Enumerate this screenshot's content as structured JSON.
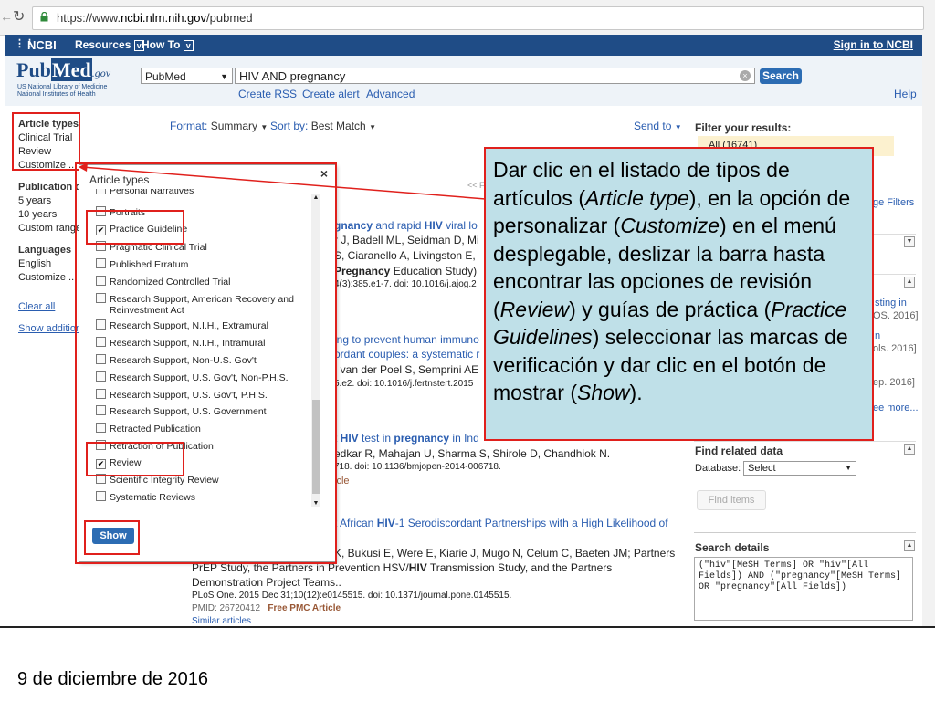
{
  "browser": {
    "url_prefix": "https://www.",
    "url_domain": "ncbi.nlm.nih.gov",
    "url_path": "/pubmed"
  },
  "ncbi_bar": {
    "logo": "NCBI",
    "resources": "Resources",
    "howto": "How To",
    "signin": "Sign in to NCBI"
  },
  "pubmed": {
    "logo_pub": "Pub",
    "logo_med": "Med",
    "logo_gov": ".gov",
    "org1": "US National Library of Medicine",
    "org2": "National Institutes of Health",
    "db_select": "PubMed",
    "query": "HIV AND pregnancy",
    "search_btn": "Search",
    "create_rss": "Create RSS",
    "create_alert": "Create alert",
    "advanced": "Advanced",
    "help": "Help"
  },
  "sidebar": {
    "article_types": "Article types",
    "clinical_trial": "Clinical Trial",
    "review": "Review",
    "customize": "Customize ...",
    "pub_dates": "Publication da",
    "five_years": "5 years",
    "ten_years": "10 years",
    "custom_range": "Custom range",
    "languages": "Languages",
    "english": "English",
    "customize2": "Customize ...",
    "clear_all": "Clear all",
    "show_additional": "Show addition"
  },
  "toolbar": {
    "format_label": "Format:",
    "format_value": "Summary",
    "sort_label": "Sort by:",
    "sort_value": "Best Match",
    "send_to": "Send to"
  },
  "popup": {
    "title": "Article types",
    "close": "×",
    "options": [
      {
        "label": "Personal Narratives",
        "checked": false
      },
      {
        "label": "Portraits",
        "checked": false
      },
      {
        "label": "Practice Guideline",
        "checked": true
      },
      {
        "label": "Pragmatic Clinical Trial",
        "checked": false
      },
      {
        "label": "Published Erratum",
        "checked": false
      },
      {
        "label": "Randomized Controlled Trial",
        "checked": false
      },
      {
        "label": "Research Support, American Recovery and",
        "label2": "Reinvestment Act",
        "checked": false
      },
      {
        "label": "Research Support, N.I.H., Extramural",
        "checked": false
      },
      {
        "label": "Research Support, N.I.H., Intramural",
        "checked": false
      },
      {
        "label": "Research Support, Non-U.S. Gov't",
        "checked": false
      },
      {
        "label": "Research Support, U.S. Gov't, Non-P.H.S.",
        "checked": false
      },
      {
        "label": "Research Support, U.S. Gov't, P.H.S.",
        "checked": false
      },
      {
        "label": "Research Support, U.S. Government",
        "checked": false
      },
      {
        "label": "Retracted Publication",
        "checked": false
      },
      {
        "label": "Retraction of Publication",
        "checked": false
      },
      {
        "label": "Review",
        "checked": true
      },
      {
        "label": "Scientific Integrity Review",
        "checked": false
      },
      {
        "label": "Systematic Reviews",
        "checked": false
      }
    ],
    "show_btn": "Show"
  },
  "results": {
    "r1_title_a": "gnancy",
    "r1_title_b": " and rapid ",
    "r1_title_c": "HIV",
    "r1_title_d": " viral lo",
    "r1_authors_a": "r J, Badell ML, Seidman D, Mi",
    "r1_authors_b": "S, Ciaranello A, Livingston E,",
    "r1_authors_c": " Pregnancy",
    "r1_authors_d": " Education Study)",
    "r1_cite": "4(3):385.e1-7. doi: 10.1016/j.ajog.2",
    "r2_title_a": "ing to prevent human immuno",
    "r2_title_b": "ordant couples: a systematic r",
    "r2_authors": ", van der Poel S, Semprini AE",
    "r2_cite": "5.e2. doi: 10.1016/j.fertnstert.2015",
    "r3_title_a": "t ",
    "r3_title_b": "HIV",
    "r3_title_c": " test in ",
    "r3_title_d": "pregnancy",
    "r3_title_e": " in Ind",
    "r3_authors": "edkar R, Mahajan U, Sharma S, Shirole D, Chandhiok N.",
    "r3_cite": "718. doi: 10.1136/bmjopen-2014-006718.",
    "r3_type": "icle",
    "r4_title_a": "t African ",
    "r4_title_b": "HIV",
    "r4_title_c": "-1 Serodiscordant Partnerships with a High Likelihood of",
    "r4_authors1": "K, Bukusi E, Were E, Kiarie J, Mugo N, Celum C, Baeten JM; Partners",
    "r4_authors2_a": "PrEP Study, the Partners in Prevention HSV/",
    "r4_authors2_b": "HIV",
    "r4_authors2_c": " Transmission Study, and the Partners",
    "r4_authors3": "Demonstration Project Teams..",
    "r4_cite": "PLoS One. 2015 Dec 31;10(12):e0145515. doi: 10.1371/journal.pone.0145515.",
    "r4_pmid": "PMID: 26720412",
    "r4_pmc": "Free PMC Article",
    "r4_similar": "Similar articles",
    "prev_marker": "<< F"
  },
  "right": {
    "filter_title": "Filter your results:",
    "all_label": "All (16741)",
    "manage_filters": "ge Filters",
    "ts1": "sting in",
    "ts2": "OS. 2016]",
    "ts3": "n",
    "ts4": "ols. 2016]",
    "ts5": "ep. 2016]",
    "see_more": "ee more...",
    "find_related": "Find related data",
    "database_label": "Database:",
    "database_value": "Select",
    "find_items": "Find items",
    "search_details": "Search details",
    "details_text": "(\"hiv\"[MeSH Terms] OR \"hiv\"[All Fields]) AND (\"pregnancy\"[MeSH Terms] OR \"pregnancy\"[All Fields])"
  },
  "callout": {
    "t1": "Dar clic en el listado de tipos de artículos (",
    "i1": "Article type",
    "t2": "), en la opción de personalizar (",
    "i2": "Customize",
    "t3": ") en el menú desplegable, deslizar la barra hasta encontrar las opciones de revisión (",
    "i3": "Review",
    "t4": ") y guías de práctica (",
    "i4": "Practice Guidelines",
    "t5": ") seleccionar las marcas de verificación y dar clic en el botón de mostrar (",
    "i5": "Show",
    "t6": ")."
  },
  "footer": {
    "date": "9 de diciembre de 2016"
  },
  "colors": {
    "ncbi_blue": "#1f4c86",
    "link": "#2a5db0",
    "highlight_red": "#e0201c",
    "callout_bg": "#bfe0e8"
  }
}
